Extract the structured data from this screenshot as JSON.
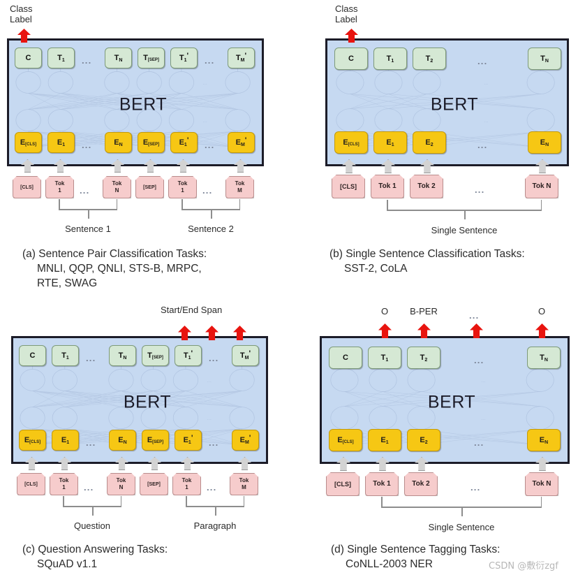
{
  "figure": {
    "model_name": "BERT",
    "watermark": "CSDN @敷衍zgf",
    "ellipsis": "...",
    "colors": {
      "bert_bg": "#c6d9f1",
      "output_green": "#d5e8d4",
      "embedding_yellow": "#f6c714",
      "token_pink": "#f6cccc",
      "arrow_red": "#e8140f",
      "arrow_grey": "#d3d3d3",
      "border_dark": "#1c1c28"
    }
  },
  "panels": [
    {
      "id": "a",
      "top_label": "Class\nLabel",
      "top_label_line1": "Class",
      "top_label_line2": "Label",
      "outputs": [
        "C",
        "T",
        "...",
        "T",
        "T",
        "T",
        "...",
        "T"
      ],
      "output_tokens": [
        {
          "base": "C",
          "sub": "",
          "prime": false
        },
        {
          "base": "T",
          "sub": "1",
          "prime": false
        },
        {
          "base": "...",
          "sub": "",
          "prime": false
        },
        {
          "base": "T",
          "sub": "N",
          "prime": false
        },
        {
          "base": "T",
          "sub": "[SEP]",
          "prime": false
        },
        {
          "base": "T",
          "sub": "1",
          "prime": true
        },
        {
          "base": "...",
          "sub": "",
          "prime": false
        },
        {
          "base": "T",
          "sub": "M",
          "prime": true
        }
      ],
      "embeddings": [
        {
          "base": "E",
          "sub": "[CLS]",
          "prime": false
        },
        {
          "base": "E",
          "sub": "1",
          "prime": false
        },
        {
          "base": "...",
          "sub": "",
          "prime": false
        },
        {
          "base": "E",
          "sub": "N",
          "prime": false
        },
        {
          "base": "E",
          "sub": "[SEP]",
          "prime": false
        },
        {
          "base": "E",
          "sub": "1",
          "prime": true
        },
        {
          "base": "...",
          "sub": "",
          "prime": false
        },
        {
          "base": "E",
          "sub": "M",
          "prime": true
        }
      ],
      "tokens": [
        {
          "line1": "[CLS]",
          "line2": ""
        },
        {
          "line1": "Tok",
          "line2": "1"
        },
        {
          "line1": "...",
          "line2": ""
        },
        {
          "line1": "Tok",
          "line2": "N"
        },
        {
          "line1": "[SEP]",
          "line2": ""
        },
        {
          "line1": "Tok",
          "line2": "1"
        },
        {
          "line1": "...",
          "line2": ""
        },
        {
          "line1": "Tok",
          "line2": "M"
        }
      ],
      "group_labels": [
        "Sentence 1",
        "Sentence 2"
      ],
      "caption_line1": "(a) Sentence Pair Classification Tasks:",
      "caption_line2": "MNLI, QQP, QNLI, STS-B, MRPC,",
      "caption_line3": "RTE, SWAG"
    },
    {
      "id": "b",
      "top_label_line1": "Class",
      "top_label_line2": "Label",
      "output_tokens": [
        {
          "base": "C",
          "sub": "",
          "prime": false
        },
        {
          "base": "T",
          "sub": "1",
          "prime": false
        },
        {
          "base": "T",
          "sub": "2",
          "prime": false
        },
        {
          "base": "...",
          "sub": "",
          "prime": false
        },
        {
          "base": "T",
          "sub": "N",
          "prime": false
        }
      ],
      "embeddings": [
        {
          "base": "E",
          "sub": "[CLS]",
          "prime": false
        },
        {
          "base": "E",
          "sub": "1",
          "prime": false
        },
        {
          "base": "E",
          "sub": "2",
          "prime": false
        },
        {
          "base": "...",
          "sub": "",
          "prime": false
        },
        {
          "base": "E",
          "sub": "N",
          "prime": false
        }
      ],
      "tokens": [
        {
          "line1": "[CLS]",
          "line2": ""
        },
        {
          "line1": "Tok 1",
          "line2": ""
        },
        {
          "line1": "Tok 2",
          "line2": ""
        },
        {
          "line1": "...",
          "line2": ""
        },
        {
          "line1": "Tok N",
          "line2": ""
        }
      ],
      "group_labels": [
        "Single Sentence"
      ],
      "caption_line1": "(b) Single Sentence Classification Tasks:",
      "caption_line2": "SST-2, CoLA",
      "caption_line3": ""
    },
    {
      "id": "c",
      "top_label_line1": "Start/End Span",
      "top_label_line2": "",
      "output_tokens": [
        {
          "base": "C",
          "sub": "",
          "prime": false
        },
        {
          "base": "T",
          "sub": "1",
          "prime": false
        },
        {
          "base": "...",
          "sub": "",
          "prime": false
        },
        {
          "base": "T",
          "sub": "N",
          "prime": false
        },
        {
          "base": "T",
          "sub": "[SEP]",
          "prime": false
        },
        {
          "base": "T",
          "sub": "1",
          "prime": true
        },
        {
          "base": "...",
          "sub": "",
          "prime": false
        },
        {
          "base": "T",
          "sub": "M",
          "prime": true
        }
      ],
      "embeddings": [
        {
          "base": "E",
          "sub": "[CLS]",
          "prime": false
        },
        {
          "base": "E",
          "sub": "1",
          "prime": false
        },
        {
          "base": "...",
          "sub": "",
          "prime": false
        },
        {
          "base": "E",
          "sub": "N",
          "prime": false
        },
        {
          "base": "E",
          "sub": "[SEP]",
          "prime": false
        },
        {
          "base": "E",
          "sub": "1",
          "prime": true
        },
        {
          "base": "...",
          "sub": "",
          "prime": false
        },
        {
          "base": "E",
          "sub": "M",
          "prime": true
        }
      ],
      "tokens": [
        {
          "line1": "[CLS]",
          "line2": ""
        },
        {
          "line1": "Tok",
          "line2": "1"
        },
        {
          "line1": "...",
          "line2": ""
        },
        {
          "line1": "Tok",
          "line2": "N"
        },
        {
          "line1": "[SEP]",
          "line2": ""
        },
        {
          "line1": "Tok",
          "line2": "1"
        },
        {
          "line1": "...",
          "line2": ""
        },
        {
          "line1": "Tok",
          "line2": "M"
        }
      ],
      "group_labels": [
        "Question",
        "Paragraph"
      ],
      "caption_line1": "(c) Question Answering Tasks:",
      "caption_line2": "SQuAD v1.1",
      "caption_line3": ""
    },
    {
      "id": "d",
      "tag_labels": [
        "O",
        "B-PER",
        "...",
        "O"
      ],
      "output_tokens": [
        {
          "base": "C",
          "sub": "",
          "prime": false
        },
        {
          "base": "T",
          "sub": "1",
          "prime": false
        },
        {
          "base": "T",
          "sub": "2",
          "prime": false
        },
        {
          "base": "...",
          "sub": "",
          "prime": false
        },
        {
          "base": "T",
          "sub": "N",
          "prime": false
        }
      ],
      "embeddings": [
        {
          "base": "E",
          "sub": "[CLS]",
          "prime": false
        },
        {
          "base": "E",
          "sub": "1",
          "prime": false
        },
        {
          "base": "E",
          "sub": "2",
          "prime": false
        },
        {
          "base": "...",
          "sub": "",
          "prime": false
        },
        {
          "base": "E",
          "sub": "N",
          "prime": false
        }
      ],
      "tokens": [
        {
          "line1": "[CLS]",
          "line2": ""
        },
        {
          "line1": "Tok 1",
          "line2": ""
        },
        {
          "line1": "Tok 2",
          "line2": ""
        },
        {
          "line1": "...",
          "line2": ""
        },
        {
          "line1": "Tok N",
          "line2": ""
        }
      ],
      "group_labels": [
        "Single Sentence"
      ],
      "caption_line1": "(d) Single Sentence Tagging Tasks:",
      "caption_line2": "CoNLL-2003 NER",
      "caption_line3": ""
    }
  ]
}
